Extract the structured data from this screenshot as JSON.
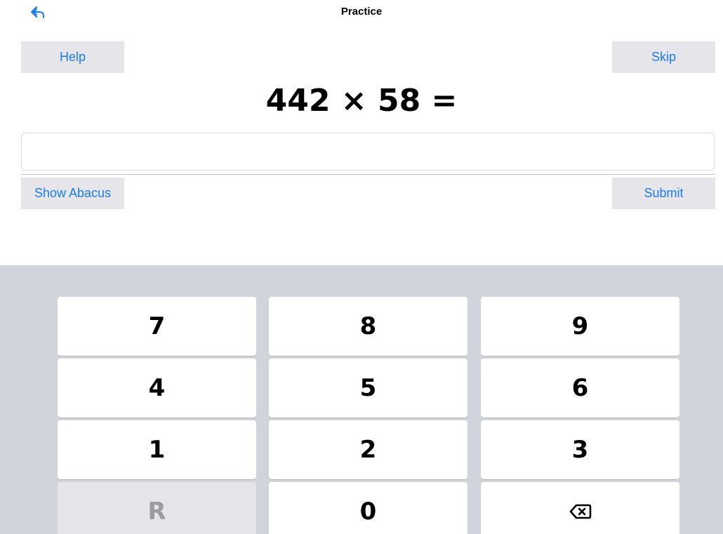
{
  "nav": {
    "title": "Practice",
    "back_icon": "back-arrow-icon",
    "accent_color": "#1a7cf0"
  },
  "actions": {
    "help_label": "Help",
    "skip_label": "Skip",
    "show_abacus_label": "Show Abacus",
    "submit_label": "Submit"
  },
  "problem": {
    "text": "442 × 58 ="
  },
  "answer": {
    "value": "",
    "placeholder": ""
  },
  "keypad": {
    "keys": [
      "7",
      "8",
      "9",
      "4",
      "5",
      "6",
      "1",
      "2",
      "3",
      "R",
      "0"
    ],
    "backspace_icon": "backspace-icon"
  }
}
